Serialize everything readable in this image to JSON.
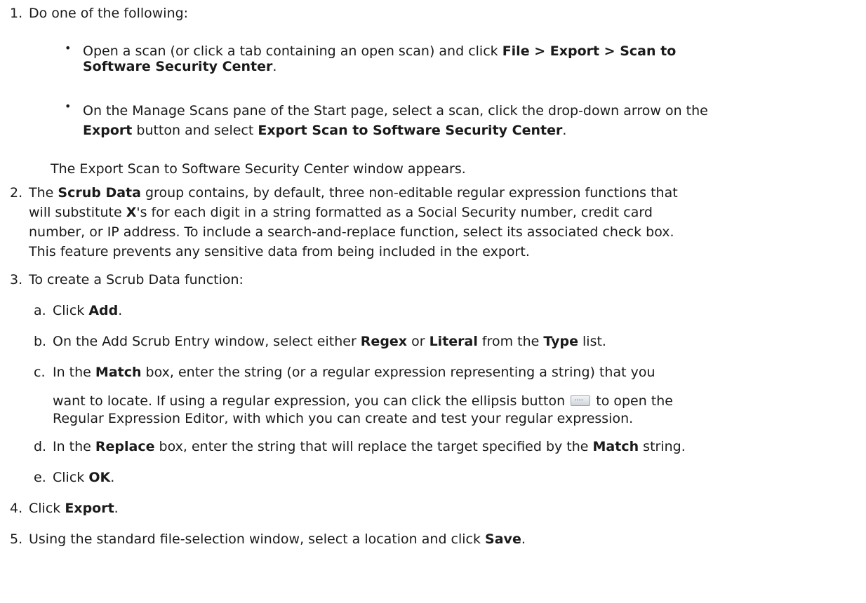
{
  "steps": {
    "s1": {
      "num": "1.",
      "text": "Do one of the following:",
      "b1": {
        "t1": "Open a scan (or click a tab containing an open scan) and click ",
        "b1": "File > Export > Scan to",
        "b2": "Software Security Center",
        "t2": "."
      },
      "b2": {
        "l1": "On the Manage Scans pane of the Start page, select a scan, click the drop-down arrow on the",
        "b1": "Export",
        "t1": " button and select ",
        "b2": "Export Scan to Software Security Center",
        "t2": "."
      },
      "result": "The Export Scan to Software Security Center window appears."
    },
    "s2": {
      "num": "2.",
      "t1": "The ",
      "b1": "Scrub Data",
      "t2": " group contains, by default, three non-editable regular expression functions that",
      "b2": "X",
      "t3": "'s for each digit in a string formatted as a Social Security number, credit card",
      "t0": "will substitute ",
      "l3": "number, or IP address. To include a search-and-replace function, select its associated check box.",
      "l4": "This feature prevents any sensitive data from being included in the export."
    },
    "s3": {
      "num": "3.",
      "text": "To create a Scrub Data function:",
      "a": {
        "num": "a.",
        "t1": "Click ",
        "b1": "Add",
        "t2": "."
      },
      "b": {
        "num": "b.",
        "t1": "On the Add Scrub Entry window, select either ",
        "b1": "Regex",
        "t2": " or ",
        "b2": "Literal",
        "t3": " from the ",
        "b3": "Type",
        "t4": " list."
      },
      "c": {
        "num": "c.",
        "t1": "In the ",
        "b1": "Match",
        "t2": " box, enter the string (or a regular expression representing a string) that you",
        "l2a": "want to locate. If using a regular expression, you can click the ellipsis button",
        "l2b": " to open the",
        "l3": "Regular Expression Editor, with which you can create and test your regular expression."
      },
      "d": {
        "num": "d.",
        "t1": "In the ",
        "b1": "Replace",
        "t2": " box, enter the string that will replace the target specified by the ",
        "b2": "Match",
        "t3": " string."
      },
      "e": {
        "num": "e.",
        "t1": "Click ",
        "b1": "OK",
        "t2": "."
      }
    },
    "s4": {
      "num": "4.",
      "t1": "Click ",
      "b1": "Export",
      "t2": "."
    },
    "s5": {
      "num": "5.",
      "t1": "Using the standard file-selection window, select a location and click ",
      "b1": "Save",
      "t2": "."
    }
  },
  "icons": {
    "ellipsis": "ellipsis-button-icon"
  }
}
